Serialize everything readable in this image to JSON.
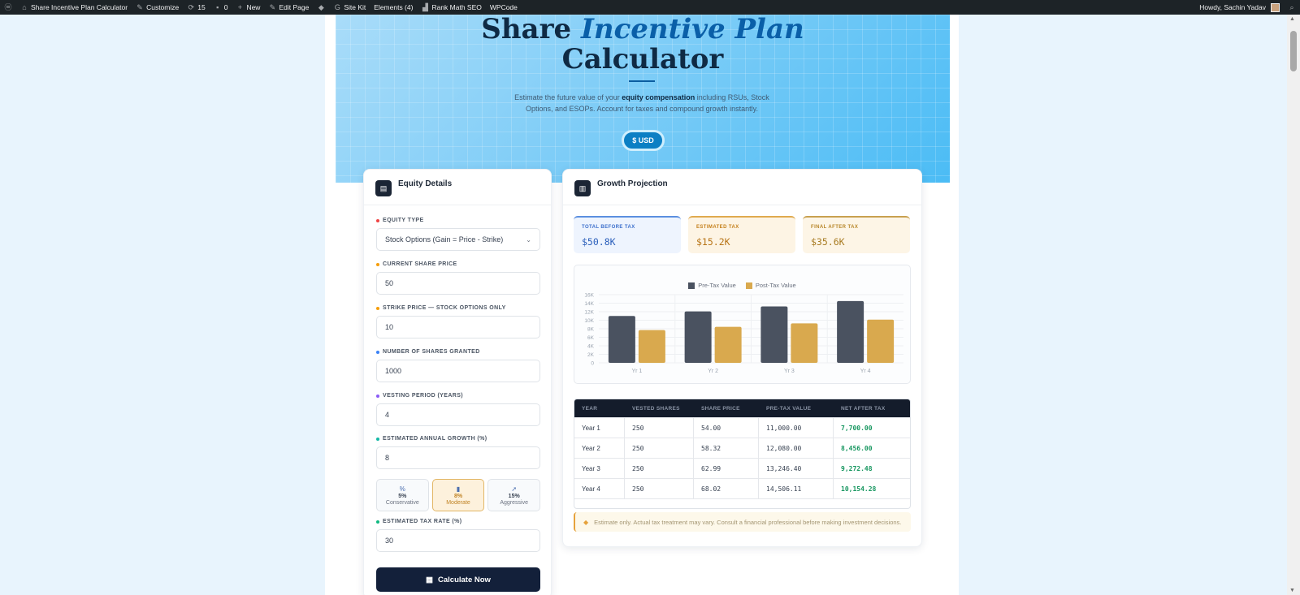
{
  "adminbar": {
    "site_name": "Share Incentive Plan Calculator",
    "customize": "Customize",
    "updates_count": "15",
    "comments_count": "0",
    "new_label": "New",
    "edit_page": "Edit Page",
    "site_kit": "Site Kit",
    "elements": "Elements (4)",
    "rank_math": "Rank Math SEO",
    "wpcode": "WPCode",
    "howdy": "Howdy, Sachin Yadav"
  },
  "hero": {
    "title_part1": "Share",
    "title_accent": "Incentive Plan",
    "title_part2": "Calculator",
    "subtitle_before": "Estimate the future value of your ",
    "subtitle_bold": "equity compensation",
    "subtitle_after": " including RSUs, Stock Options, and ESOPs. Account for taxes and compound growth instantly.",
    "currency_button": "$ USD"
  },
  "equity": {
    "title": "Equity Details",
    "fields": {
      "equity_type": {
        "label": "EQUITY TYPE",
        "value": "Stock Options (Gain = Price - Strike)"
      },
      "share_price": {
        "label": "CURRENT SHARE PRICE",
        "value": "50"
      },
      "strike_price": {
        "label": "STRIKE PRICE — STOCK OPTIONS ONLY",
        "value": "10"
      },
      "shares": {
        "label": "NUMBER OF SHARES GRANTED",
        "value": "1000"
      },
      "vesting": {
        "label": "VESTING PERIOD (YEARS)",
        "value": "4"
      },
      "growth": {
        "label": "ESTIMATED ANNUAL GROWTH (%)",
        "value": "8"
      },
      "tax": {
        "label": "ESTIMATED TAX RATE (%)",
        "value": "30"
      }
    },
    "presets": [
      {
        "icon": "%",
        "pct": "5%",
        "name": "Conservative"
      },
      {
        "icon": "▮",
        "pct": "8%",
        "name": "Moderate"
      },
      {
        "icon": "➚",
        "pct": "15%",
        "name": "Aggressive"
      }
    ],
    "calculate_label": "Calculate Now"
  },
  "growth": {
    "title": "Growth Projection",
    "stats": {
      "total_before_label": "TOTAL BEFORE TAX",
      "total_before_value": "$50.8K",
      "estimated_tax_label": "ESTIMATED TAX",
      "estimated_tax_value": "$15.2K",
      "final_after_label": "FINAL AFTER TAX",
      "final_after_value": "$35.6K"
    },
    "table": {
      "headers": [
        "YEAR",
        "VESTED SHARES",
        "SHARE PRICE",
        "PRE-TAX VALUE",
        "NET AFTER TAX"
      ],
      "rows": [
        [
          "Year 1",
          "250",
          "54.00",
          "11,000.00",
          "7,700.00"
        ],
        [
          "Year 2",
          "250",
          "58.32",
          "12,080.00",
          "8,456.00"
        ],
        [
          "Year 3",
          "250",
          "62.99",
          "13,246.40",
          "9,272.48"
        ],
        [
          "Year 4",
          "250",
          "68.02",
          "14,506.11",
          "10,154.28"
        ]
      ]
    },
    "note": "Estimate only. Actual tax treatment may vary. Consult a financial professional before making investment decisions."
  },
  "chart_data": {
    "type": "bar",
    "categories": [
      "Yr 1",
      "Yr 2",
      "Yr 3",
      "Yr 4"
    ],
    "series": [
      {
        "name": "Pre-Tax Value",
        "values": [
          11000,
          12080,
          13246.4,
          14506.11
        ],
        "color": "#4a5260"
      },
      {
        "name": "Post-Tax Value",
        "values": [
          7700,
          8456,
          9272.48,
          10154.28
        ],
        "color": "#d9a94e"
      }
    ],
    "ylim": [
      0,
      16000
    ],
    "yticks": [
      "0",
      "2K",
      "4K",
      "6K",
      "8K",
      "10K",
      "12K",
      "14K",
      "16K"
    ],
    "legend_position": "top-center",
    "grid": true
  },
  "colors": {
    "accent": "#0b7fc4",
    "dark": "#13203a",
    "gain": "#16965f"
  }
}
